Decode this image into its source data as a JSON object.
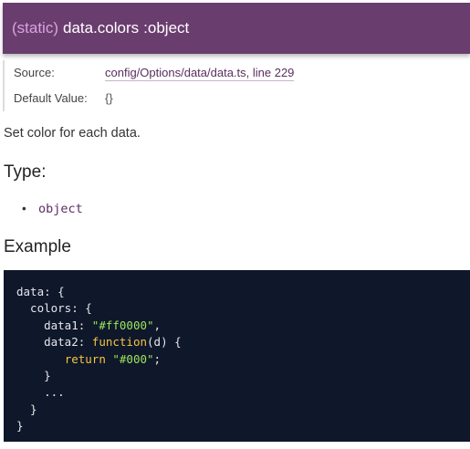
{
  "header": {
    "static_tag": "(static)",
    "member_name": "data.colors",
    "member_type": ":object"
  },
  "details": {
    "source_label": "Source:",
    "source_link": "config/Options/data/data.ts, line 229",
    "default_label": "Default Value:",
    "default_value": "{}"
  },
  "description": "Set color for each data.",
  "type_section": {
    "heading": "Type:",
    "items": [
      "object"
    ]
  },
  "example_section": {
    "heading": "Example"
  },
  "code": {
    "lines": [
      [
        {
          "t": "data: {",
          "c": "plain"
        }
      ],
      [
        {
          "t": "  colors: {",
          "c": "plain"
        }
      ],
      [
        {
          "t": "    data1: ",
          "c": "plain"
        },
        {
          "t": "\"#ff0000\"",
          "c": "str"
        },
        {
          "t": ",",
          "c": "plain"
        }
      ],
      [
        {
          "t": "    data2: ",
          "c": "plain"
        },
        {
          "t": "function",
          "c": "fn"
        },
        {
          "t": "(d) {",
          "c": "plain"
        }
      ],
      [
        {
          "t": "       ",
          "c": "plain"
        },
        {
          "t": "return",
          "c": "kw"
        },
        {
          "t": " ",
          "c": "plain"
        },
        {
          "t": "\"#000\"",
          "c": "str"
        },
        {
          "t": ";",
          "c": "plain"
        }
      ],
      [
        {
          "t": "    }",
          "c": "plain"
        }
      ],
      [
        {
          "t": "    ...",
          "c": "plain"
        }
      ],
      [
        {
          "t": "  }",
          "c": "plain"
        }
      ],
      [
        {
          "t": "}",
          "c": "plain"
        }
      ]
    ]
  },
  "colors": {
    "header_bg": "#6a3d6f",
    "static_tag": "#d9a3dd",
    "code_bg": "#0f172a",
    "code_string": "#9ae65e",
    "code_keyword": "#f5c542",
    "type_text": "#5e2a66"
  }
}
